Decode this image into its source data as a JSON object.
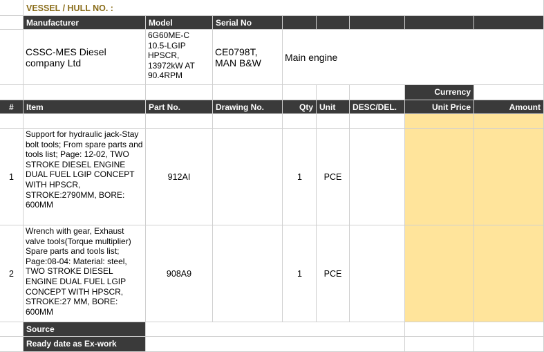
{
  "vessel_label": "VESSEL / HULL NO. :",
  "headers1": {
    "manufacturer": "Manufacturer",
    "model": "Model",
    "serial": "Serial No"
  },
  "engine": {
    "manufacturer": "CSSC-MES Diesel company Ltd",
    "model": "6G60ME-C 10.5-LGIP HPSCR, 13972kW AT 90.4RPM",
    "serial": "CE0798T, MAN B&W",
    "type": "Main engine"
  },
  "currency_label": "Currency",
  "headers2": {
    "num": "#",
    "item": "Item",
    "part": "Part No.",
    "drawing": "Drawing No.",
    "qty": "Qty",
    "unit": "Unit",
    "desc": "DESC/DEL.",
    "unit_price": "Unit Price",
    "amount": "Amount"
  },
  "rows": [
    {
      "num": "1",
      "item": "Support for hydraulic jack-Stay bolt tools; From spare parts and tools list; Page: 12-02, TWO STROKE DIESEL ENGINE DUAL FUEL LGIP CONCEPT WITH HPSCR, STROKE:2790MM, BORE: 600MM",
      "part": "912AI",
      "qty": "1",
      "unit": "PCE"
    },
    {
      "num": "2",
      "item": "Wrench with gear, Exhaust valve tools(Torque multiplier) Spare parts and tools list; Page:08-04: Material: steel, TWO STROKE DIESEL ENGINE DUAL FUEL LGIP CONCEPT WITH HPSCR, STROKE:27 MM, BORE: 600MM",
      "part": "908A9",
      "qty": "1",
      "unit": "PCE"
    }
  ],
  "footer": {
    "source": "Source",
    "ready": "Ready date as Ex-work"
  },
  "colors": {
    "header_bg": "#3a3a3a",
    "price_bg": "#ffe49b",
    "title_color": "#8a6d1a"
  }
}
